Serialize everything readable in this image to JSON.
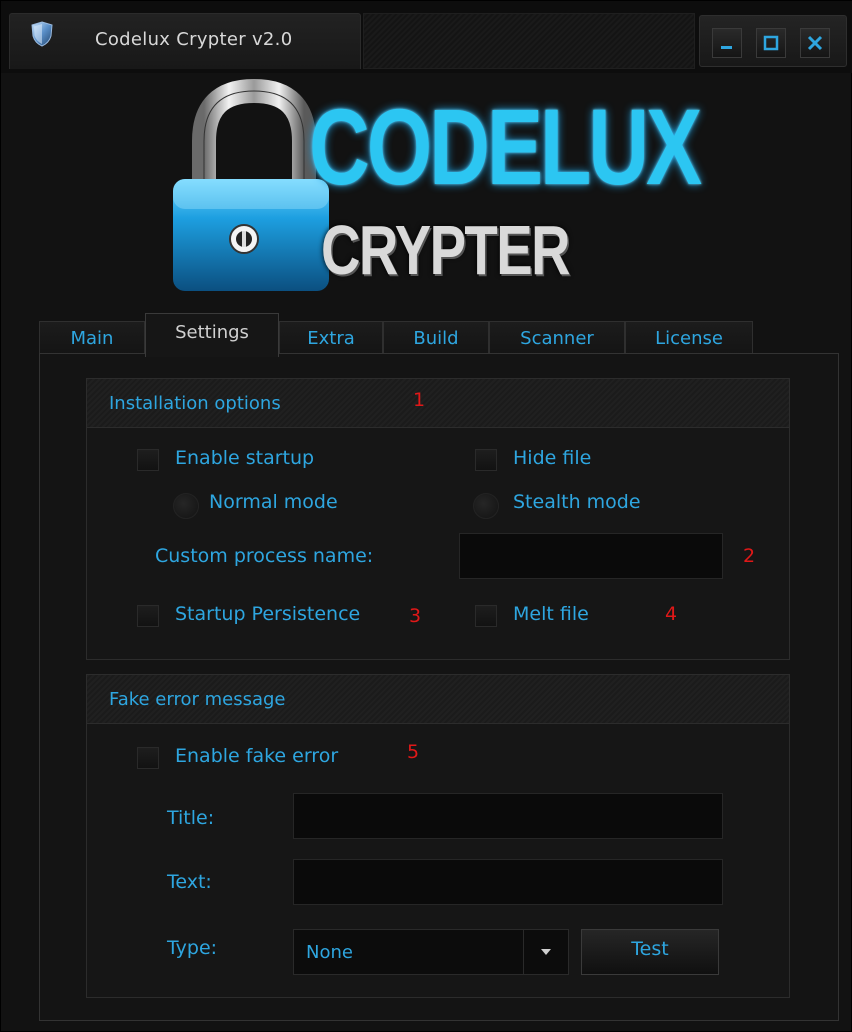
{
  "window": {
    "title": "Codelux Crypter v2.0",
    "controls": [
      "minimize",
      "maximize",
      "close"
    ]
  },
  "logo": {
    "line1": "CODELUX",
    "line2": "CRYPTER",
    "icon": "padlock-icon",
    "accent_color": "#2cc6f2"
  },
  "tabs": [
    {
      "label": "Main",
      "active": false
    },
    {
      "label": "Settings",
      "active": true
    },
    {
      "label": "Extra",
      "active": false
    },
    {
      "label": "Build",
      "active": false
    },
    {
      "label": "Scanner",
      "active": false
    },
    {
      "label": "License",
      "active": false
    }
  ],
  "installation": {
    "title": "Installation options",
    "annotation": "1",
    "enable_startup": {
      "label": "Enable startup",
      "checked": false
    },
    "hide_file": {
      "label": "Hide file",
      "checked": false
    },
    "normal_mode": {
      "label": "Normal mode",
      "selected": false
    },
    "stealth_mode": {
      "label": "Stealth mode",
      "selected": false
    },
    "custom_process": {
      "label": "Custom process name:",
      "value": "",
      "annotation": "2"
    },
    "startup_persistence": {
      "label": "Startup Persistence",
      "checked": false,
      "annotation": "3"
    },
    "melt_file": {
      "label": "Melt file",
      "checked": false,
      "annotation": "4"
    }
  },
  "fake_error": {
    "title": "Fake error message",
    "enable": {
      "label": "Enable fake error",
      "checked": false,
      "annotation": "5"
    },
    "title_field": {
      "label": "Title:",
      "value": ""
    },
    "text_field": {
      "label": "Text:",
      "value": ""
    },
    "type_field": {
      "label": "Type:",
      "value": "None"
    },
    "test_button": "Test"
  },
  "colors": {
    "text_accent": "#2ea6e0",
    "annotation": "#e01818",
    "background": "#121212"
  }
}
